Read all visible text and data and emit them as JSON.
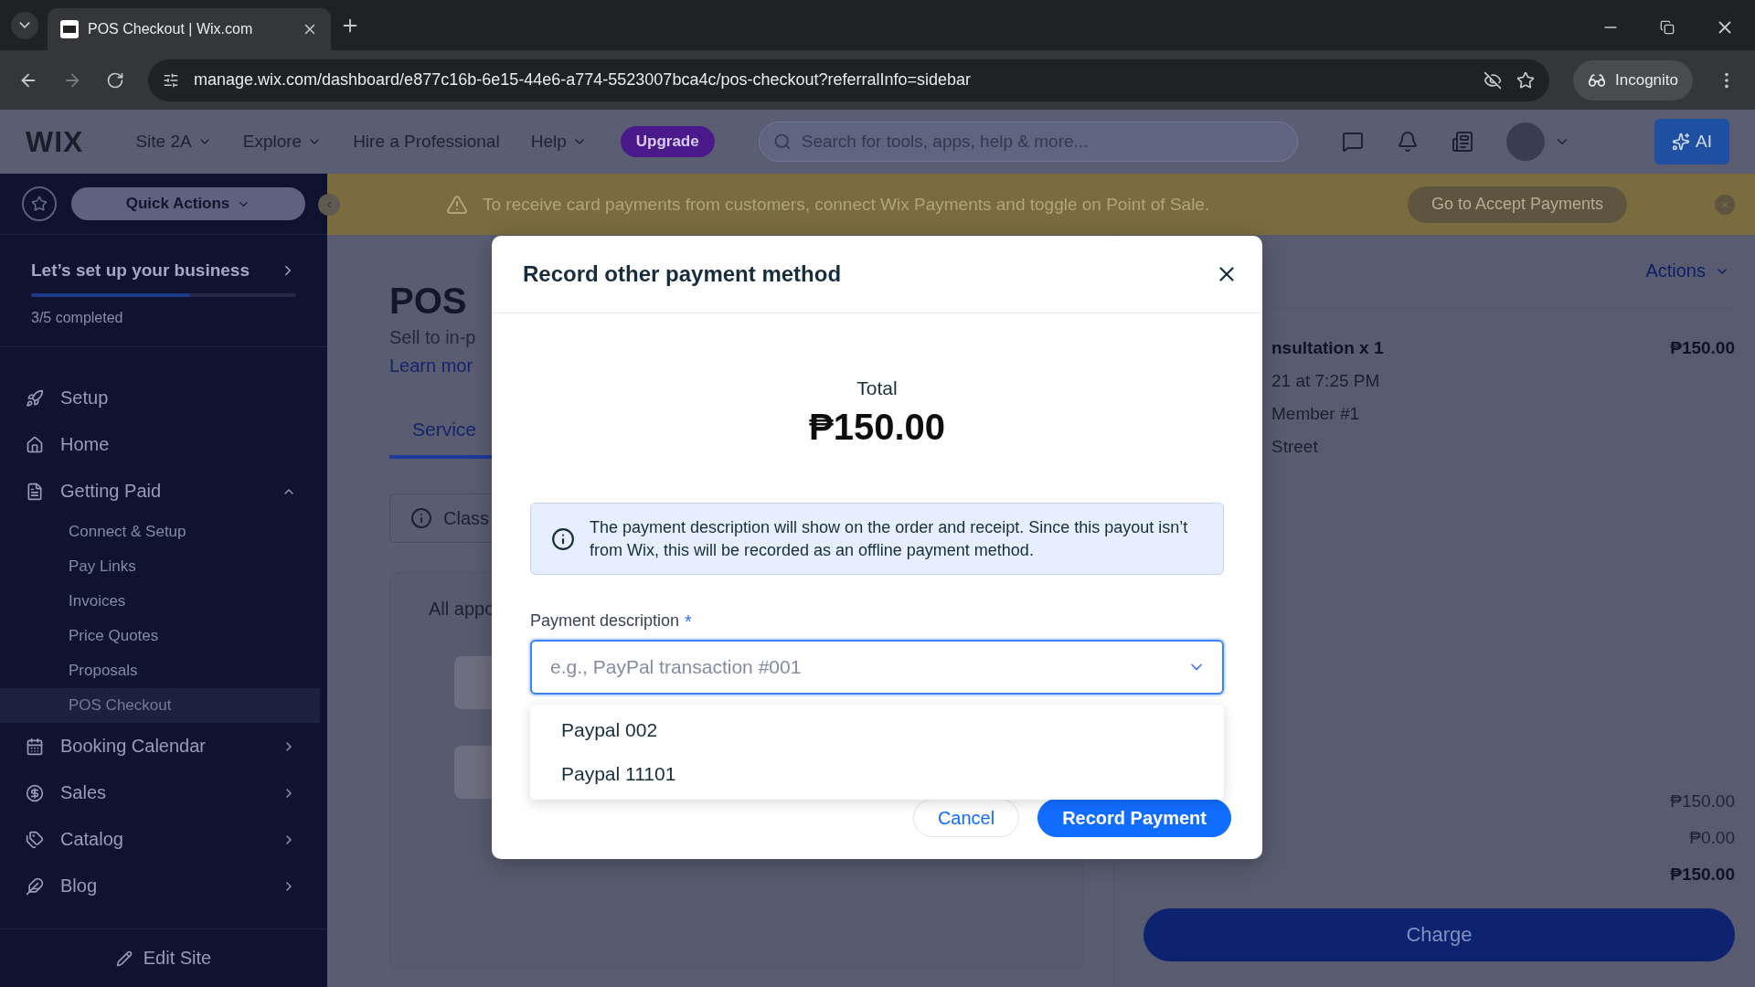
{
  "browser": {
    "tabs": [
      {
        "title": "POS Checkout | Wix.com",
        "selected": true
      }
    ],
    "url": "manage.wix.com/dashboard/e877c16b-6e15-44e6-a774-5523007bca4c/pos-checkout?referralInfo=sidebar",
    "profile": "Incognito"
  },
  "header": {
    "logo": "WIX",
    "menu": [
      {
        "label": "Site 2A",
        "dropdown": true
      },
      {
        "label": "Explore",
        "dropdown": true
      },
      {
        "label": "Hire a Professional",
        "dropdown": false
      },
      {
        "label": "Help",
        "dropdown": true
      }
    ],
    "upgrade": "Upgrade",
    "search": {
      "placeholder": "Search for tools, apps, help & more..."
    },
    "ai": "AI"
  },
  "banner": {
    "message": "To receive card payments from customers, connect Wix Payments and toggle on Point of Sale.",
    "button": "Go to Accept Payments"
  },
  "sidebar": {
    "quick_actions": "Quick Actions",
    "setup": {
      "title": "Let’s set up your business",
      "level": 0.6,
      "progress": "3/5 completed"
    },
    "items": [
      {
        "label": "Setup"
      },
      {
        "label": "Home"
      },
      {
        "label": "Getting Paid",
        "expanded": true,
        "children": [
          {
            "label": "Connect & Setup",
            "selected": false
          },
          {
            "label": "Pay Links",
            "selected": false
          },
          {
            "label": "Invoices",
            "selected": false
          },
          {
            "label": "Price Quotes",
            "selected": false
          },
          {
            "label": "Proposals",
            "selected": false
          },
          {
            "label": "POS Checkout",
            "selected": true
          }
        ]
      },
      {
        "label": "Booking Calendar",
        "expanded": false
      },
      {
        "label": "Sales",
        "expanded": false
      },
      {
        "label": "Catalog",
        "expanded": false
      },
      {
        "label": "Blog",
        "expanded": false
      }
    ],
    "edit_site": "Edit Site"
  },
  "main": {
    "title": "POS",
    "subtitle": "Sell to in-p",
    "link": "Learn mor",
    "tabs": [
      {
        "label": "Service",
        "selected": true
      }
    ],
    "notice": "Class",
    "list_heading": "All appo"
  },
  "order": {
    "actions": "Actions",
    "item": {
      "name": "nsultation x 1",
      "price": "₱150.00",
      "details": [
        "21 at 7:25 PM",
        "Member #1",
        "Street"
      ]
    },
    "summary": [
      {
        "value": "₱150.00",
        "kind": "line"
      },
      {
        "value": "₱0.00",
        "kind": "line"
      },
      {
        "value": "₱150.00",
        "kind": "total"
      }
    ],
    "charge": "Charge"
  },
  "dialog": {
    "title": "Record other payment method",
    "total_label": "Total",
    "total": "₱150.00",
    "notice": "The payment description will show on the order and receipt. Since this payout isn’t from Wix, this will be recorded as an offline payment method.",
    "field": {
      "label": "Payment description",
      "required_mark": "*",
      "placeholder": "e.g., PayPal transaction #001"
    },
    "options": [
      "Paypal 002",
      "Paypal 11101"
    ],
    "buttons": [
      {
        "label": "Cancel",
        "kind": "secondary"
      },
      {
        "label": "Record Payment",
        "kind": "primary"
      }
    ]
  }
}
